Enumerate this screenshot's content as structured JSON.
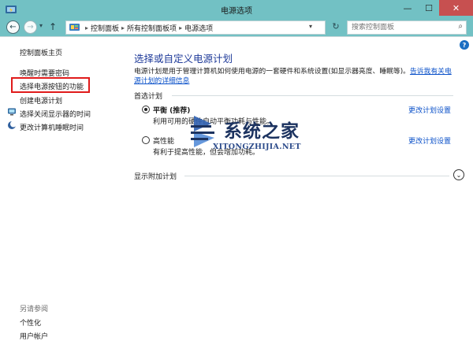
{
  "window": {
    "title": "电源选项",
    "min_label": "—",
    "max_label": "☐",
    "close_label": "✕"
  },
  "nav": {
    "back_glyph": "←",
    "forward_glyph": "→",
    "dropdown_glyph": "▾",
    "up_glyph": "↑",
    "refresh_glyph": "↻"
  },
  "breadcrumb": {
    "items": [
      "控制面板",
      "所有控制面板项",
      "电源选项"
    ],
    "separator": "▸",
    "dropdown_glyph": "▾"
  },
  "search": {
    "placeholder": "搜索控制面板",
    "icon_glyph": "⌕"
  },
  "help": {
    "glyph": "?"
  },
  "left_pane": {
    "home": "控制面板主页",
    "links": [
      "唤醒时需要密码",
      "选择电源按钮的功能",
      "创建电源计划",
      "选择关闭显示器的时间",
      "更改计算机睡眠时间"
    ],
    "see_also_label": "另请参阅",
    "see_also": [
      "个性化",
      "用户帐户"
    ]
  },
  "main": {
    "title": "选择或自定义电源计划",
    "description": "电源计划是用于管理计算机如何使用电源的一套硬件和系统设置(如显示器亮度、睡眠等)。",
    "description_link": "告诉我有关电源计划的详细信息",
    "preferred_header": "首选计划",
    "plans": [
      {
        "name": "平衡 (推荐)",
        "desc": "利用可用的硬件自动平衡功耗与性能。",
        "selected": true,
        "change_label": "更改计划设置"
      },
      {
        "name": "高性能",
        "desc": "有利于提高性能，但会增加功耗。",
        "selected": false,
        "change_label": "更改计划设置"
      }
    ],
    "more_plans": "显示附加计划",
    "expand_glyph": "⌄"
  },
  "watermark": {
    "brand": "系统之家",
    "url": "XITONGZHIJIA.NET"
  },
  "colors": {
    "titlebar": "#72c1c4",
    "link_blue": "#0b51c9",
    "title_blue": "#1e3a99",
    "highlight_red": "#e01b1b",
    "close_red": "#c75050"
  }
}
